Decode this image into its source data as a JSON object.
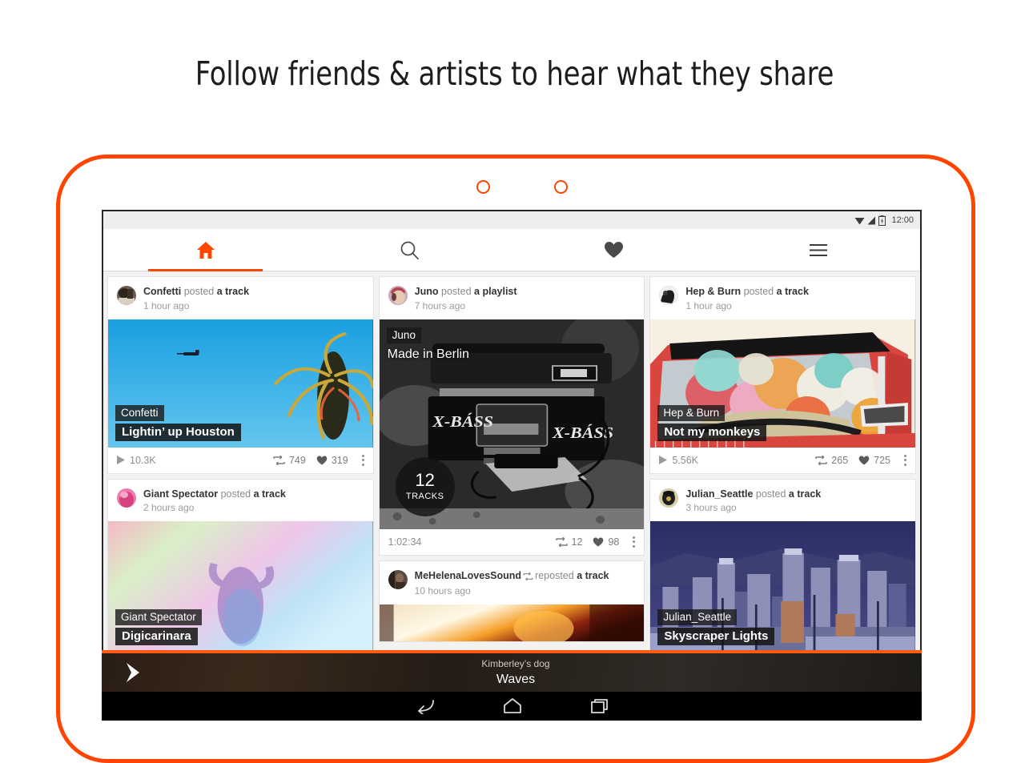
{
  "headline": "Follow friends & artists to hear what they share",
  "colors": {
    "accent": "#ff4500",
    "player_accent": "#ff5a12",
    "feed_bg": "#f2f2f2"
  },
  "device": {
    "camera_dots": 2,
    "statusbar": {
      "time": "12:00",
      "icons": [
        "wifi-icon",
        "signal-icon",
        "battery-charging-icon"
      ]
    },
    "navbar": {
      "back": "back-icon",
      "home": "home-icon",
      "recents": "recents-icon"
    }
  },
  "tabs": [
    {
      "name": "home",
      "icon": "home-icon",
      "active": true
    },
    {
      "name": "search",
      "icon": "search-icon",
      "active": false
    },
    {
      "name": "likes",
      "icon": "heart-icon",
      "active": false
    },
    {
      "name": "more",
      "icon": "menu-icon",
      "active": false
    }
  ],
  "feed": {
    "columns": [
      {
        "cards": [
          {
            "user": "Confetti",
            "action_verb": "posted",
            "action_object": "a track",
            "time": "1 hour ago",
            "reposted": false,
            "art_user_tag": "Confetti",
            "art_title_tag": "Lightin’ up Houston",
            "art_kind": "palm-sky",
            "foot_left": "10.3K",
            "foot_left_icon": "play-icon",
            "reposts": "749",
            "likes": "319",
            "menu": "kebab-icon"
          },
          {
            "user": "Giant Spectator",
            "action_verb": "posted",
            "action_object": "a track",
            "time": "2 hours ago",
            "reposted": false,
            "art_user_tag": "Giant Spectator",
            "art_title_tag": "Digicarinara",
            "art_kind": "smoke-figure",
            "foot_left": "",
            "foot_left_icon": "",
            "reposts": "",
            "likes": "",
            "menu": ""
          }
        ]
      },
      {
        "cards": [
          {
            "user": "Juno",
            "action_verb": "posted",
            "action_object": "a playlist",
            "time": "7 hours ago",
            "reposted": false,
            "art_user_tag": "Juno",
            "art_title_tag": "Made in Berlin",
            "art_kind": "boombox",
            "badge_count": "12",
            "badge_label": "TRACKS",
            "foot_left": "1:02:34",
            "foot_left_icon": "",
            "reposts": "12",
            "likes": "98",
            "menu": "kebab-icon"
          },
          {
            "user": "MeHelenaLovesSound",
            "action_verb": "reposted",
            "action_object": "a track",
            "time": "10 hours ago",
            "reposted": true,
            "art_user_tag": "",
            "art_title_tag": "",
            "art_kind": "fire",
            "foot_left": "",
            "foot_left_icon": "",
            "reposts": "",
            "likes": "",
            "menu": ""
          }
        ]
      },
      {
        "cards": [
          {
            "user": "Hep & Burn",
            "action_verb": "posted",
            "action_object": "a track",
            "time": "1 hour ago",
            "reposted": false,
            "art_user_tag": "Hep & Burn",
            "art_title_tag": "Not my monkeys",
            "art_kind": "balloons-car",
            "foot_left": "5.56K",
            "foot_left_icon": "play-icon",
            "reposts": "265",
            "likes": "725",
            "menu": "kebab-icon"
          },
          {
            "user": "Julian_Seattle",
            "action_verb": "posted",
            "action_object": "a track",
            "time": "3 hours ago",
            "reposted": false,
            "art_user_tag": "Julian_Seattle",
            "art_title_tag": "Skyscraper Lights",
            "art_kind": "skyline",
            "foot_left": "",
            "foot_left_icon": "",
            "reposts": "",
            "likes": "",
            "menu": ""
          }
        ]
      }
    ]
  },
  "player": {
    "play_icon": "play-icon",
    "artist": "Kimberley’s dog",
    "track": "Waves"
  }
}
